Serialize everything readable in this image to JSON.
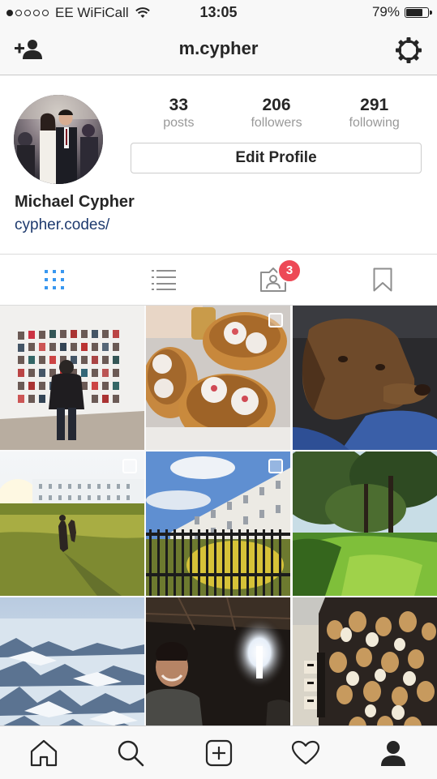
{
  "status_bar": {
    "carrier": "EE WiFiCall",
    "time": "13:05",
    "battery_text": "79%",
    "battery_level": 0.79,
    "signal_bars_filled": 1,
    "signal_bars_total": 5
  },
  "nav": {
    "username": "m.cypher",
    "left_icon": "add-user-icon",
    "right_icon": "gear-icon"
  },
  "profile": {
    "posts_count": "33",
    "posts_label": "posts",
    "followers_count": "206",
    "followers_label": "followers",
    "following_count": "291",
    "following_label": "following",
    "edit_button": "Edit Profile",
    "full_name": "Michael Cypher",
    "website": "cypher.codes/"
  },
  "tabs": {
    "items": [
      {
        "name": "grid-view",
        "icon": "grid-icon",
        "active": true
      },
      {
        "name": "list-view",
        "icon": "list-icon",
        "active": false
      },
      {
        "name": "tagged",
        "icon": "tagged-photos-icon",
        "active": false,
        "badge": "3"
      },
      {
        "name": "saved",
        "icon": "bookmark-icon",
        "active": false
      }
    ],
    "active_color": "#3897f0",
    "badge_color": "#ed4956"
  },
  "photos": [
    {
      "subject": "gallery-wall-portraits",
      "multi": false
    },
    {
      "subject": "dim-sum-baskets",
      "multi": true
    },
    {
      "subject": "brown-dog-in-car",
      "multi": false
    },
    {
      "subject": "park-sunset-terrace",
      "multi": true
    },
    {
      "subject": "white-terrace-railings",
      "multi": true
    },
    {
      "subject": "sunlit-trees-park",
      "multi": false
    },
    {
      "subject": "aerial-snowy-mountains",
      "multi": false
    },
    {
      "subject": "man-smiling-dark-room",
      "multi": false
    },
    {
      "subject": "dog-mural-wall",
      "multi": false
    }
  ],
  "bottom_nav": {
    "items": [
      {
        "name": "home",
        "icon": "home-icon"
      },
      {
        "name": "search",
        "icon": "search-icon"
      },
      {
        "name": "new-post",
        "icon": "plus-square-icon"
      },
      {
        "name": "activity",
        "icon": "heart-icon"
      },
      {
        "name": "profile",
        "icon": "person-icon",
        "active": true
      }
    ]
  }
}
